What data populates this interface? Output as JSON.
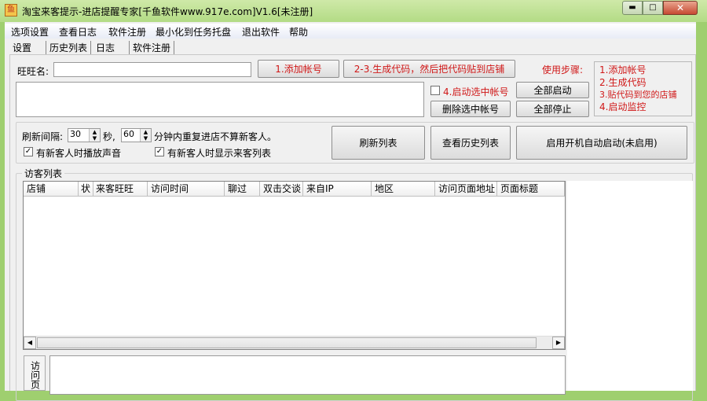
{
  "window": {
    "title": "淘宝来客提示-进店提醒专家[千鱼软件www.917e.com]V1.6[未注册]",
    "app_icon": "app-icon"
  },
  "menu": [
    "选项设置",
    "查看日志",
    "软件注册",
    "最小化到任务托盘",
    "退出软件",
    "帮助"
  ],
  "tabs": [
    "设置",
    "历史列表",
    "日志",
    "软件注册"
  ],
  "account": {
    "label": "旺旺名:",
    "value": "",
    "add_button": "1.添加帐号",
    "generate_button": "2-3.生成代码，然后把代码贴到店铺",
    "start_selected": "4.启动选中帐号",
    "delete_selected": "删除选中帐号",
    "start_all": "全部启动",
    "stop_all": "全部停止"
  },
  "steps": {
    "title": "使用步骤:",
    "items": [
      "1.添加帐号",
      "2.生成代码",
      "3.贴代码到您的店铺",
      "4.启动监控"
    ]
  },
  "settings": {
    "interval_label": "刷新间隔:",
    "interval_value": "30",
    "seconds_label": "秒,",
    "repeat_value": "60",
    "repeat_label": "分钟内重复进店不算新客人。",
    "play_sound": "有新客人时播放声音",
    "play_sound_checked": true,
    "show_list": "有新客人时显示来客列表",
    "show_list_checked": true,
    "refresh_button": "刷新列表",
    "history_button": "查看历史列表",
    "autostart_button": "启用开机自动启动(未启用)"
  },
  "visitors": {
    "group_label": "访客列表",
    "columns": [
      "店铺",
      "状",
      "来客旺旺",
      "访问时间",
      "聊过",
      "双击交谈",
      "来自IP",
      "地区",
      "访问页面地址",
      "页面标题"
    ],
    "rows": []
  },
  "bottom": {
    "side_tab": "访问页"
  }
}
